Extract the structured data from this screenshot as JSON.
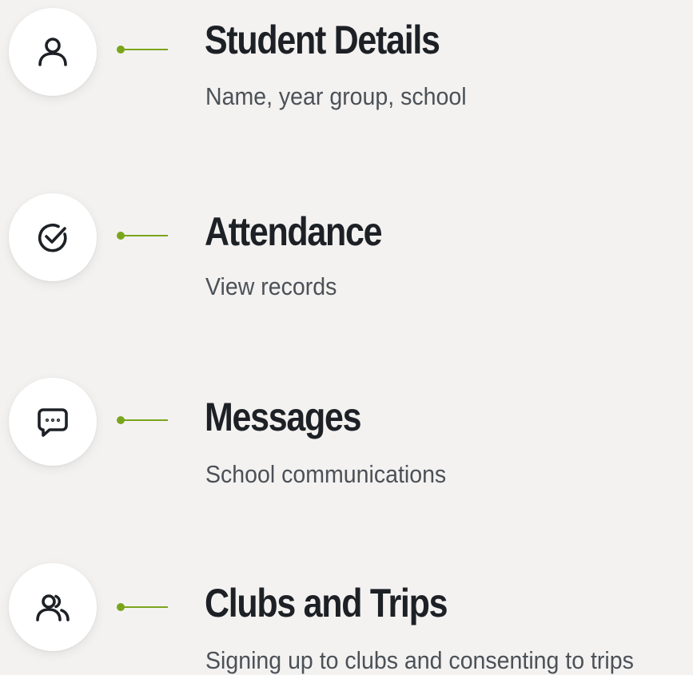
{
  "accent_color": "#7aa51b",
  "menu": {
    "items": [
      {
        "icon": "user-icon",
        "title": "Student Details",
        "subtitle": "Name, year group, school"
      },
      {
        "icon": "check-circle-icon",
        "title": "Attendance",
        "subtitle": "View records"
      },
      {
        "icon": "chat-bubble-icon",
        "title": "Messages",
        "subtitle": "School communications"
      },
      {
        "icon": "users-icon",
        "title": "Clubs and Trips",
        "subtitle": "Signing up to clubs and consenting to trips"
      }
    ]
  }
}
